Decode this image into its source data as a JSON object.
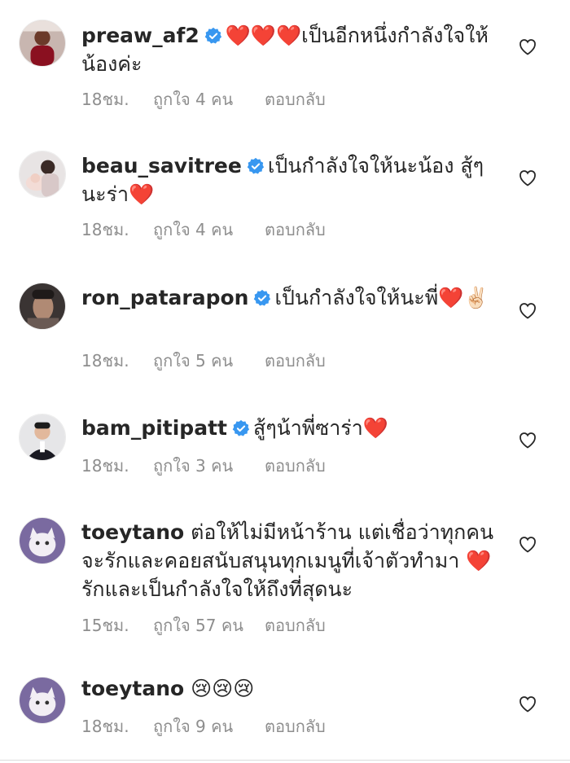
{
  "comments": [
    {
      "username": "preaw_af2",
      "verified": true,
      "text": "❤️❤️❤️เป็นอีกหนึ่งกำลังใจให้น้องค่ะ",
      "time": "18ชม.",
      "likes": "ถูกใจ 4 คน",
      "reply": "ตอบกลับ"
    },
    {
      "username": "beau_savitree",
      "verified": true,
      "text": "เป็นกำลังใจให้นะน้อง สู้ๆนะร่า❤️",
      "time": "18ชม.",
      "likes": "ถูกใจ 4 คน",
      "reply": "ตอบกลับ"
    },
    {
      "username": "ron_patarapon",
      "verified": true,
      "text": "เป็นกำลังใจให้นะพี่❤️✌🏻",
      "time": "18ชม.",
      "likes": "ถูกใจ 5 คน",
      "reply": "ตอบกลับ"
    },
    {
      "username": "bam_pitipatt",
      "verified": true,
      "text": "สู้ๆน้าพี่ซาร่า❤️",
      "time": "18ชม.",
      "likes": "ถูกใจ 3 คน",
      "reply": "ตอบกลับ"
    },
    {
      "username": "toeytano",
      "verified": false,
      "text": "ต่อให้ไม่มีหน้าร้าน แต่เชื่อว่าทุกคนจะรักและคอยสนับสนุนทุกเมนูที่เจ้าตัวทำมา ❤️ รักและเป็นกำลังใจให้ถึงที่สุดนะ",
      "time": "15ชม.",
      "likes": "ถูกใจ 57 คน",
      "reply": "ตอบกลับ"
    },
    {
      "username": "toeytano",
      "verified": false,
      "text": "😢😢😢",
      "time": "18ชม.",
      "likes": "ถูกใจ 9 คน",
      "reply": "ตอบกลับ"
    }
  ],
  "colors": {
    "text": "#262626",
    "meta": "#8e8e8e",
    "verified": "#3897f0",
    "heart": "#e0142a"
  },
  "icons": {
    "verified": "verified-badge-icon",
    "like": "heart-outline-icon"
  }
}
